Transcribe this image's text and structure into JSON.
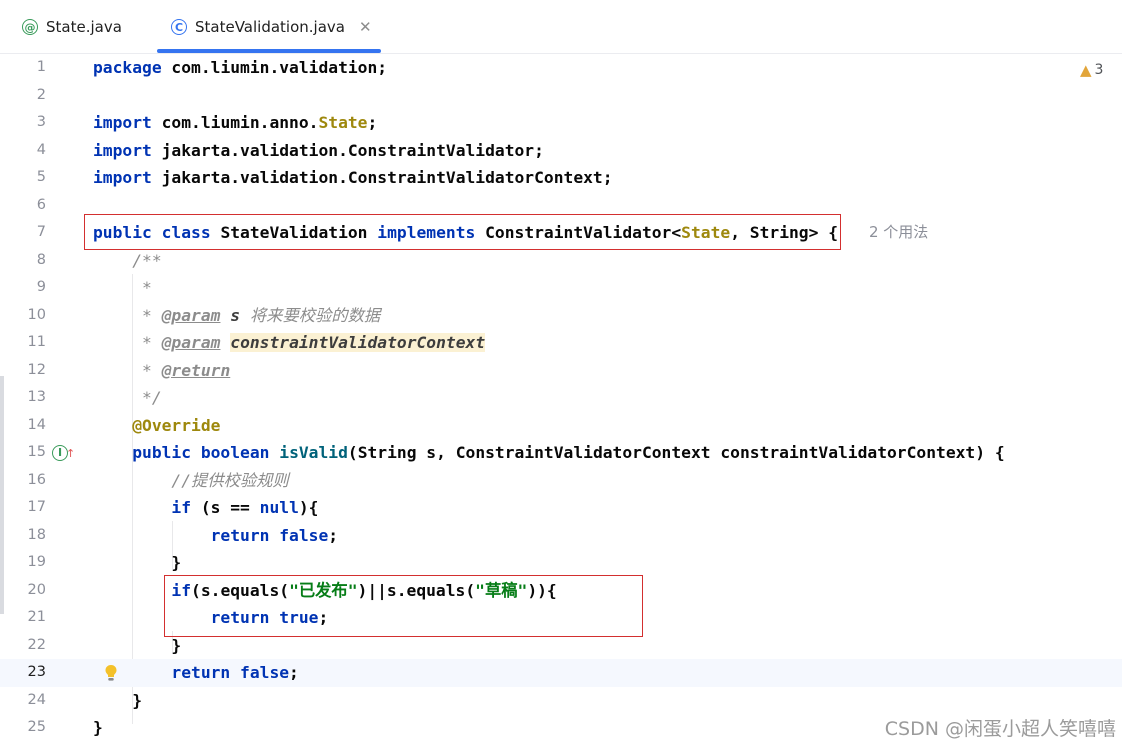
{
  "tabs": [
    {
      "label": "State.java",
      "icon": "annotation-icon",
      "active": false
    },
    {
      "label": "StateValidation.java",
      "icon": "class-icon",
      "active": true
    }
  ],
  "inspection": {
    "warning_count": "3"
  },
  "code_hint": "2 个用法",
  "lines": [
    {
      "n": "1",
      "tokens": [
        [
          "kw",
          "package"
        ],
        [
          "plain",
          " com.liumin.validation;"
        ]
      ]
    },
    {
      "n": "2",
      "tokens": []
    },
    {
      "n": "3",
      "tokens": [
        [
          "kw",
          "import"
        ],
        [
          "plain",
          " com.liumin.anno."
        ],
        [
          "ty",
          "State"
        ],
        [
          "plain",
          ";"
        ]
      ]
    },
    {
      "n": "4",
      "tokens": [
        [
          "kw",
          "import"
        ],
        [
          "plain",
          " jakarta.validation.ConstraintValidator;"
        ]
      ]
    },
    {
      "n": "5",
      "tokens": [
        [
          "kw",
          "import"
        ],
        [
          "plain",
          " jakarta.validation.ConstraintValidatorContext;"
        ]
      ]
    },
    {
      "n": "6",
      "tokens": []
    },
    {
      "n": "7",
      "tokens": [
        [
          "kw",
          "public class"
        ],
        [
          "plain",
          " StateValidation "
        ],
        [
          "kw",
          "implements"
        ],
        [
          "plain",
          " ConstraintValidator<"
        ],
        [
          "ty",
          "State"
        ],
        [
          "plain",
          ", String> {"
        ]
      ]
    },
    {
      "n": "8",
      "tokens": [
        [
          "cm",
          "    /**"
        ]
      ]
    },
    {
      "n": "9",
      "tokens": [
        [
          "cm",
          "     *"
        ]
      ]
    },
    {
      "n": "10",
      "tokens": [
        [
          "cm",
          "     * "
        ],
        [
          "doctag",
          "@param"
        ],
        [
          "cm",
          " "
        ],
        [
          "docparam",
          "s"
        ],
        [
          "cm",
          " 将来要校验的数据"
        ]
      ]
    },
    {
      "n": "11",
      "tokens": [
        [
          "cm",
          "     * "
        ],
        [
          "doctag",
          "@param"
        ],
        [
          "cm",
          " "
        ],
        [
          "docparam hl",
          "constraintValidatorContext"
        ]
      ]
    },
    {
      "n": "12",
      "tokens": [
        [
          "cm",
          "     * "
        ],
        [
          "doctag",
          "@return"
        ]
      ]
    },
    {
      "n": "13",
      "tokens": [
        [
          "cm",
          "     */"
        ]
      ]
    },
    {
      "n": "14",
      "tokens": [
        [
          "anno",
          "    @Override"
        ]
      ]
    },
    {
      "n": "15",
      "tokens": [
        [
          "kw",
          "    public boolean"
        ],
        [
          "plain",
          " "
        ],
        [
          "method",
          "isValid"
        ],
        [
          "plain",
          "(String s, ConstraintValidatorContext constraintValidatorContext) {"
        ]
      ]
    },
    {
      "n": "16",
      "tokens": [
        [
          "cm",
          "        //提供校验规则"
        ]
      ]
    },
    {
      "n": "17",
      "tokens": [
        [
          "kw",
          "        if"
        ],
        [
          "plain",
          " (s == "
        ],
        [
          "kw",
          "null"
        ],
        [
          "plain",
          "){"
        ]
      ]
    },
    {
      "n": "18",
      "tokens": [
        [
          "kw",
          "            return false"
        ],
        [
          "plain",
          ";"
        ]
      ]
    },
    {
      "n": "19",
      "tokens": [
        [
          "plain",
          "        }"
        ]
      ]
    },
    {
      "n": "20",
      "tokens": [
        [
          "kw",
          "        if"
        ],
        [
          "plain",
          "(s.equals("
        ],
        [
          "str",
          "\"已发布\""
        ],
        [
          "plain",
          ")||s.equals("
        ],
        [
          "str",
          "\"草稿\""
        ],
        [
          "plain",
          ")){"
        ]
      ]
    },
    {
      "n": "21",
      "tokens": [
        [
          "kw",
          "            return true"
        ],
        [
          "plain",
          ";"
        ]
      ]
    },
    {
      "n": "22",
      "tokens": [
        [
          "plain",
          "        }"
        ]
      ]
    },
    {
      "n": "23",
      "tokens": [
        [
          "kw",
          "        return false"
        ],
        [
          "plain",
          ";"
        ]
      ]
    },
    {
      "n": "24",
      "tokens": [
        [
          "plain",
          "    }"
        ]
      ]
    },
    {
      "n": "25",
      "tokens": [
        [
          "plain",
          "}"
        ]
      ]
    }
  ],
  "current_line": "23",
  "watermark": "CSDN @闲蛋小超人笑嘻嘻"
}
